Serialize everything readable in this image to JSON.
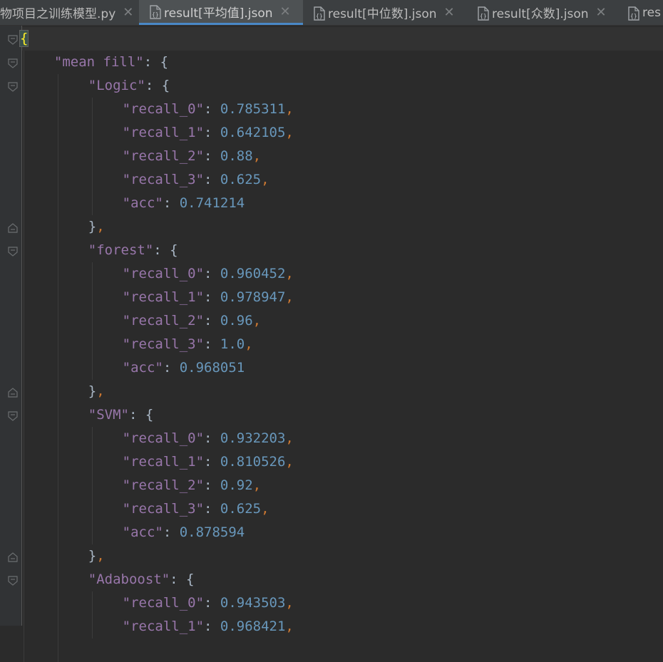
{
  "tabs": [
    {
      "label": "物项目之训练模型.py",
      "type": "py",
      "active": false
    },
    {
      "label": "result[平均值].json",
      "type": "json",
      "active": true
    },
    {
      "label": "result[中位数].json",
      "type": "json",
      "active": false
    },
    {
      "label": "result[众数].json",
      "type": "json",
      "active": false
    },
    {
      "label": "res",
      "type": "json",
      "active": false
    }
  ],
  "close_glyph": "✕",
  "code": {
    "open_brace": "{",
    "top_key": "\"mean fill\"",
    "models": [
      {
        "name": "\"Logic\"",
        "metrics": [
          {
            "k": "\"recall_0\"",
            "v": "0.785311",
            "comma": ","
          },
          {
            "k": "\"recall_1\"",
            "v": "0.642105",
            "comma": ","
          },
          {
            "k": "\"recall_2\"",
            "v": "0.88",
            "comma": ","
          },
          {
            "k": "\"recall_3\"",
            "v": "0.625",
            "comma": ","
          },
          {
            "k": "\"acc\"",
            "v": "0.741214",
            "comma": ""
          }
        ]
      },
      {
        "name": "\"forest\"",
        "metrics": [
          {
            "k": "\"recall_0\"",
            "v": "0.960452",
            "comma": ","
          },
          {
            "k": "\"recall_1\"",
            "v": "0.978947",
            "comma": ","
          },
          {
            "k": "\"recall_2\"",
            "v": "0.96",
            "comma": ","
          },
          {
            "k": "\"recall_3\"",
            "v": "1.0",
            "comma": ","
          },
          {
            "k": "\"acc\"",
            "v": "0.968051",
            "comma": ""
          }
        ]
      },
      {
        "name": "\"SVM\"",
        "metrics": [
          {
            "k": "\"recall_0\"",
            "v": "0.932203",
            "comma": ","
          },
          {
            "k": "\"recall_1\"",
            "v": "0.810526",
            "comma": ","
          },
          {
            "k": "\"recall_2\"",
            "v": "0.92",
            "comma": ","
          },
          {
            "k": "\"recall_3\"",
            "v": "0.625",
            "comma": ","
          },
          {
            "k": "\"acc\"",
            "v": "0.878594",
            "comma": ""
          }
        ]
      },
      {
        "name": "\"Adaboost\"",
        "metrics": [
          {
            "k": "\"recall_0\"",
            "v": "0.943503",
            "comma": ","
          },
          {
            "k": "\"recall_1\"",
            "v": "0.968421",
            "comma": ","
          }
        ]
      }
    ],
    "close_block": "},",
    "colon": ": ",
    "open": "{"
  },
  "colors": {
    "background": "#2b2b2b",
    "key": "#9876aa",
    "number": "#6897bb",
    "punctuation": "#a9b7c6",
    "comma": "#cc7832",
    "active_tab_underline": "#4a88c7"
  }
}
